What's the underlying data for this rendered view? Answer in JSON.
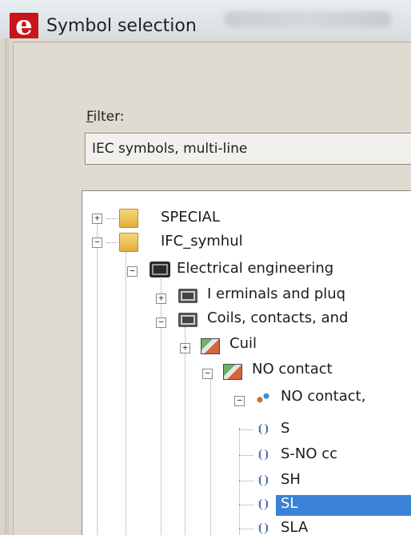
{
  "window": {
    "title": "Symbol selection",
    "app_icon": "eplan-e-icon",
    "app_icon_letter": "e"
  },
  "filter": {
    "label_prefix": "F",
    "label_rest": "ilter:",
    "value": "IEC symbols, multi-line"
  },
  "tree": {
    "nodes": [
      {
        "label": "SPECIAL",
        "toggle": "+",
        "icon": "folder-icon"
      },
      {
        "label": "IFC_symhul",
        "toggle": "−",
        "icon": "folder-icon"
      },
      {
        "label": "Electrical engineering",
        "toggle": "−",
        "icon": "electrical-engineering-icon"
      },
      {
        "label": "I erminals and pluq",
        "toggle": "+",
        "icon": "symbol-group-icon"
      },
      {
        "label": "Coils, contacts, and",
        "toggle": "−",
        "icon": "symbol-group-icon"
      },
      {
        "label": "Cuil",
        "toggle": "+",
        "icon": "symbol-category-icon"
      },
      {
        "label": "NO contact",
        "toggle": "−",
        "icon": "symbol-category-icon"
      },
      {
        "label": "NO contact,",
        "toggle": "−",
        "icon": "symbol-subcategory-icon"
      },
      {
        "label": "S",
        "icon": "symbol-leaf-icon"
      },
      {
        "label": "S-NO cc",
        "icon": "symbol-leaf-icon"
      },
      {
        "label": "SH",
        "icon": "symbol-leaf-icon"
      },
      {
        "label": "SL",
        "icon": "symbol-leaf-icon",
        "selected": true
      },
      {
        "label": "SLA",
        "icon": "symbol-leaf-icon"
      }
    ]
  },
  "colors": {
    "selection": "#3a82d6",
    "app_icon": "#c8141a"
  }
}
